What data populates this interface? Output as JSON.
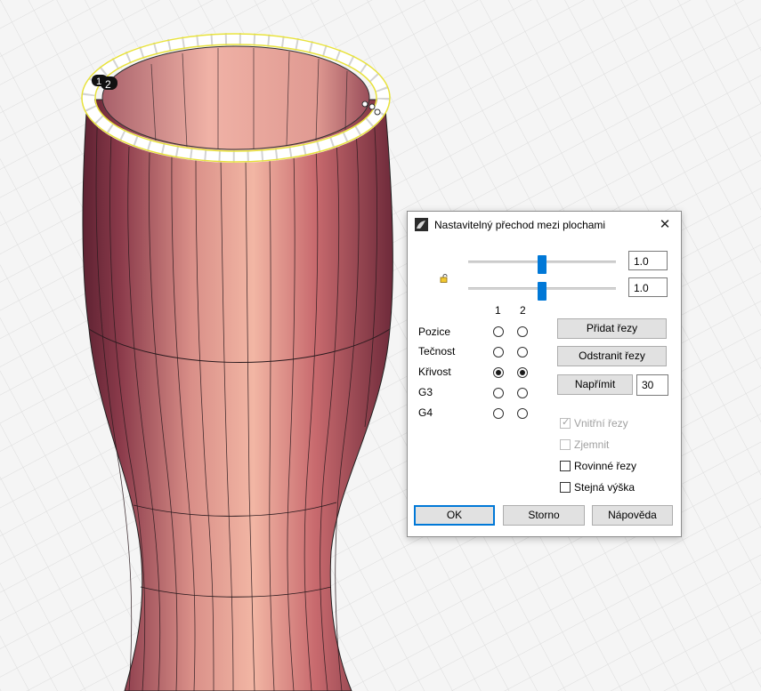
{
  "dialog": {
    "title": "Nastavitelný přechod mezi plochami",
    "close_label": "✕",
    "slider1_value": "1.0",
    "slider2_value": "1.0",
    "col1": "1",
    "col2": "2",
    "rows": [
      {
        "label": "Pozice",
        "sel1": false,
        "sel2": false
      },
      {
        "label": "Tečnost",
        "sel1": false,
        "sel2": false
      },
      {
        "label": "Křivost",
        "sel1": true,
        "sel2": true
      },
      {
        "label": "G3",
        "sel1": false,
        "sel2": false
      },
      {
        "label": "G4",
        "sel1": false,
        "sel2": false
      }
    ],
    "add_sections": "Přidat řezy",
    "remove_sections": "Odstranit řezy",
    "straighten": "Napřímit",
    "straighten_value": "30",
    "checks": [
      {
        "label": "Vnitřní řezy",
        "checked": true,
        "disabled": true
      },
      {
        "label": "Zjemnit",
        "checked": false,
        "disabled": true
      },
      {
        "label": "Rovinné řezy",
        "checked": false,
        "disabled": false
      },
      {
        "label": "Stejná výška",
        "checked": false,
        "disabled": false
      }
    ],
    "ok": "OK",
    "cancel": "Storno",
    "help": "Nápověda"
  },
  "viewport": {
    "edge_labels": [
      "1",
      "2"
    ]
  }
}
